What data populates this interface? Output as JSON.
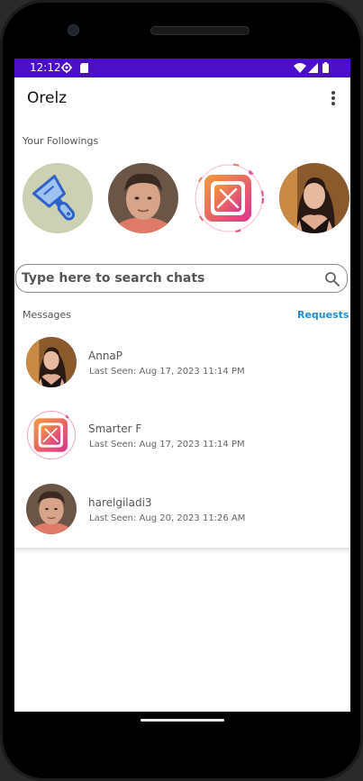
{
  "status_bar": {
    "time": "12:12",
    "icons": [
      "gear-icon",
      "sd-card-icon",
      "wifi-icon",
      "signal-icon",
      "battery-icon"
    ],
    "background_color": "#4a0fc7"
  },
  "app_bar": {
    "title": "Orelz",
    "menu_icon": "more-vert-icon"
  },
  "followings": {
    "label": "Your Followings",
    "items": [
      {
        "name": "putty-knife-avatar"
      },
      {
        "name": "man-avatar"
      },
      {
        "name": "restaurant-app-avatar"
      },
      {
        "name": "woman-avatar"
      }
    ]
  },
  "search": {
    "placeholder": "Type here to search chats",
    "icon": "search-icon"
  },
  "messages": {
    "label": "Messages",
    "requests_label": "Requests",
    "accent_color": "#1a8fd0",
    "chats": [
      {
        "name": "AnnaP",
        "last_seen": "Last Seen: Aug 17, 2023 11:14 PM"
      },
      {
        "name": "Smarter F",
        "last_seen": "Last Seen: Aug 17, 2023 11:14 PM"
      },
      {
        "name": "harelgiladi3",
        "last_seen": "Last Seen: Aug 20, 2023 11:26 AM"
      }
    ]
  }
}
